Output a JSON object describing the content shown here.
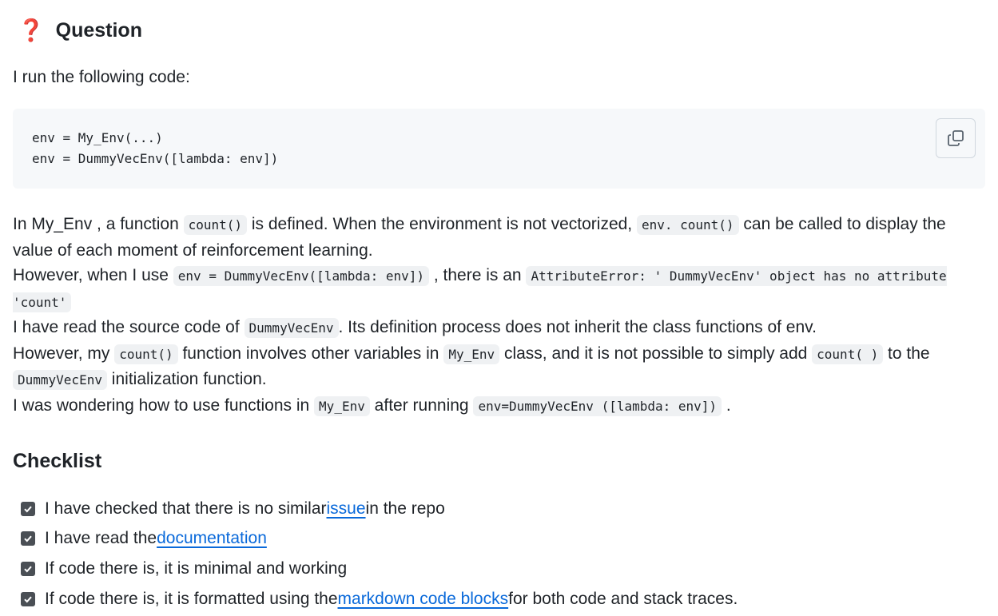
{
  "question": {
    "emoji": "❓",
    "title": "Question",
    "intro": "I run the following code:",
    "code_lines": [
      "env = My_Env(...)",
      "env = DummyVecEnv([lambda: env])"
    ],
    "copy_button": "copy-icon",
    "p1": {
      "t1": "In My_Env , a function ",
      "c1": "count()",
      "t2": " is defined. When the environment is not vectorized, ",
      "c2": "env. count()",
      "t3": " can be called to display the value of each moment of reinforcement learning."
    },
    "p2": {
      "t1": "However, when I use ",
      "c1": "env = DummyVecEnv([lambda: env])",
      "t2": " , there is an ",
      "c2": "AttributeError: ' DummyVecEnv' object has no attribute 'count'"
    },
    "p3": {
      "t1": "I have read the source code of ",
      "c1": "DummyVecEnv",
      "t2": ". Its definition process does not inherit the class functions of env."
    },
    "p4": {
      "t1": "However, my ",
      "c1": "count()",
      "t2": " function involves other variables in ",
      "c2": "My_Env",
      "t3": " class, and it is not possible to simply add ",
      "c3": "count( )",
      "t4": " to the ",
      "c4": "DummyVecEnv",
      "t5": " initialization function."
    },
    "p5": {
      "t1": "I was wondering how to use functions in ",
      "c1": "My_Env",
      "t2": " after running ",
      "c2": "env=DummyVecEnv ([lambda: env])",
      "t3": " ."
    }
  },
  "checklist": {
    "title": "Checklist",
    "items": [
      {
        "before": "I have checked that there is no similar ",
        "link": "issue",
        "after": " in the repo",
        "checked": true
      },
      {
        "before": "I have read the ",
        "link": "documentation",
        "after": "",
        "checked": true
      },
      {
        "before": "If code there is, it is minimal and working",
        "link": "",
        "after": "",
        "checked": true
      },
      {
        "before": "If code there is, it is formatted using the ",
        "link": "markdown code blocks",
        "after": " for both code and stack traces.",
        "checked": true
      }
    ]
  },
  "colors": {
    "link": "#0969da",
    "code_bg": "#eff1f3",
    "block_bg": "#f6f8fa",
    "emoji": "#e0323a"
  }
}
